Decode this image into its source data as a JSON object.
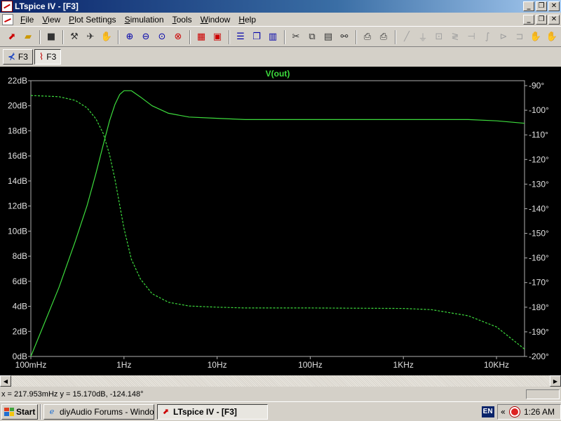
{
  "window": {
    "title": "LTspice IV - [F3]",
    "controls": [
      "_",
      "❐",
      "✕"
    ]
  },
  "menu": {
    "items": [
      {
        "label": "File",
        "accel": "F"
      },
      {
        "label": "View",
        "accel": "V"
      },
      {
        "label": "Plot Settings",
        "accel": "P"
      },
      {
        "label": "Simulation",
        "accel": "S"
      },
      {
        "label": "Tools",
        "accel": "T"
      },
      {
        "label": "Window",
        "accel": "W"
      },
      {
        "label": "Help",
        "accel": "H"
      }
    ]
  },
  "tabs": [
    {
      "label": "F3",
      "icon": "schematic-icon"
    },
    {
      "label": "F3",
      "icon": "waveform-icon"
    }
  ],
  "chart_data": {
    "type": "line",
    "title": "V(out)",
    "x_scale": "log",
    "xlim": [
      0.1,
      20000
    ],
    "x_ticks": [
      0.1,
      1,
      10,
      100,
      1000,
      10000
    ],
    "x_tick_labels": [
      "100mHz",
      "1Hz",
      "10Hz",
      "100Hz",
      "1KHz",
      "10KHz"
    ],
    "ylim_left": [
      0,
      22
    ],
    "y_ticks_left": [
      0,
      2,
      4,
      6,
      8,
      10,
      12,
      14,
      16,
      18,
      20,
      22
    ],
    "y_tick_labels_left": [
      "0dB",
      "2dB",
      "4dB",
      "6dB",
      "8dB",
      "10dB",
      "12dB",
      "14dB",
      "16dB",
      "18dB",
      "20dB",
      "22dB"
    ],
    "ylim_right": [
      -200,
      -88
    ],
    "y_ticks_right": [
      -200,
      -190,
      -180,
      -170,
      -160,
      -150,
      -140,
      -130,
      -120,
      -110,
      -100,
      -90
    ],
    "y_tick_labels_right": [
      "-200°",
      "-190°",
      "-180°",
      "-170°",
      "-160°",
      "-150°",
      "-140°",
      "-130°",
      "-120°",
      "-110°",
      "-100°",
      "-90°"
    ],
    "grid": false,
    "series": [
      {
        "axis": "left",
        "style": "solid",
        "color": "#3ddc3d",
        "x": [
          0.1,
          0.2,
          0.3,
          0.4,
          0.5,
          0.6,
          0.7,
          0.8,
          0.9,
          1.0,
          1.2,
          1.5,
          2,
          3,
          5,
          10,
          20,
          100,
          1000,
          5000,
          10000,
          20000
        ],
        "y": [
          0.0,
          5.5,
          9.2,
          12.0,
          14.6,
          16.9,
          18.8,
          20.1,
          20.9,
          21.2,
          21.2,
          20.7,
          20.0,
          19.4,
          19.1,
          19.0,
          18.9,
          18.9,
          18.9,
          18.9,
          18.8,
          18.6
        ]
      },
      {
        "axis": "right",
        "style": "dashed",
        "color": "#3ddc3d",
        "x": [
          0.1,
          0.2,
          0.3,
          0.4,
          0.5,
          0.6,
          0.7,
          0.8,
          1.0,
          1.2,
          1.5,
          2,
          3,
          5,
          10,
          20,
          100,
          1000,
          2000,
          5000,
          10000,
          20000
        ],
        "y": [
          -94.0,
          -94.5,
          -96.0,
          -99.0,
          -103.5,
          -109.5,
          -118.0,
          -128.0,
          -148.0,
          -160.5,
          -168.5,
          -174.5,
          -178.0,
          -179.5,
          -180.0,
          -180.3,
          -180.3,
          -180.5,
          -181.0,
          -183.5,
          -188.0,
          -197.0
        ]
      }
    ]
  },
  "status": {
    "cursor": "x = 217.953mHz    y = 15.170dB, -124.148°"
  },
  "taskbar": {
    "start": "Start",
    "tasks": [
      {
        "label": "diyAudio Forums - Windo...",
        "active": false
      },
      {
        "label": "LTspice IV - [F3]",
        "active": true
      }
    ],
    "lang": "EN",
    "clock": "1:26 AM"
  }
}
